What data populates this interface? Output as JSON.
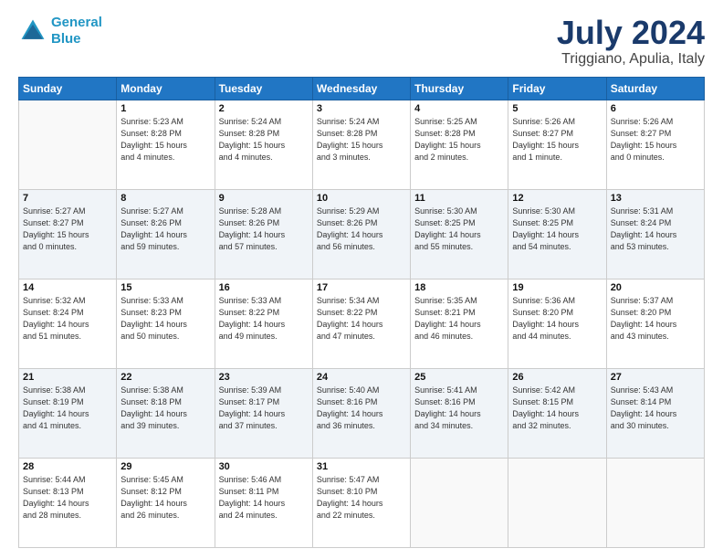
{
  "header": {
    "logo_line1": "General",
    "logo_line2": "Blue",
    "title": "July 2024",
    "subtitle": "Triggiano, Apulia, Italy"
  },
  "days_of_week": [
    "Sunday",
    "Monday",
    "Tuesday",
    "Wednesday",
    "Thursday",
    "Friday",
    "Saturday"
  ],
  "weeks": [
    [
      {
        "day": "",
        "info": ""
      },
      {
        "day": "1",
        "info": "Sunrise: 5:23 AM\nSunset: 8:28 PM\nDaylight: 15 hours\nand 4 minutes."
      },
      {
        "day": "2",
        "info": "Sunrise: 5:24 AM\nSunset: 8:28 PM\nDaylight: 15 hours\nand 4 minutes."
      },
      {
        "day": "3",
        "info": "Sunrise: 5:24 AM\nSunset: 8:28 PM\nDaylight: 15 hours\nand 3 minutes."
      },
      {
        "day": "4",
        "info": "Sunrise: 5:25 AM\nSunset: 8:28 PM\nDaylight: 15 hours\nand 2 minutes."
      },
      {
        "day": "5",
        "info": "Sunrise: 5:26 AM\nSunset: 8:27 PM\nDaylight: 15 hours\nand 1 minute."
      },
      {
        "day": "6",
        "info": "Sunrise: 5:26 AM\nSunset: 8:27 PM\nDaylight: 15 hours\nand 0 minutes."
      }
    ],
    [
      {
        "day": "7",
        "info": "Sunrise: 5:27 AM\nSunset: 8:27 PM\nDaylight: 15 hours\nand 0 minutes."
      },
      {
        "day": "8",
        "info": "Sunrise: 5:27 AM\nSunset: 8:26 PM\nDaylight: 14 hours\nand 59 minutes."
      },
      {
        "day": "9",
        "info": "Sunrise: 5:28 AM\nSunset: 8:26 PM\nDaylight: 14 hours\nand 57 minutes."
      },
      {
        "day": "10",
        "info": "Sunrise: 5:29 AM\nSunset: 8:26 PM\nDaylight: 14 hours\nand 56 minutes."
      },
      {
        "day": "11",
        "info": "Sunrise: 5:30 AM\nSunset: 8:25 PM\nDaylight: 14 hours\nand 55 minutes."
      },
      {
        "day": "12",
        "info": "Sunrise: 5:30 AM\nSunset: 8:25 PM\nDaylight: 14 hours\nand 54 minutes."
      },
      {
        "day": "13",
        "info": "Sunrise: 5:31 AM\nSunset: 8:24 PM\nDaylight: 14 hours\nand 53 minutes."
      }
    ],
    [
      {
        "day": "14",
        "info": "Sunrise: 5:32 AM\nSunset: 8:24 PM\nDaylight: 14 hours\nand 51 minutes."
      },
      {
        "day": "15",
        "info": "Sunrise: 5:33 AM\nSunset: 8:23 PM\nDaylight: 14 hours\nand 50 minutes."
      },
      {
        "day": "16",
        "info": "Sunrise: 5:33 AM\nSunset: 8:22 PM\nDaylight: 14 hours\nand 49 minutes."
      },
      {
        "day": "17",
        "info": "Sunrise: 5:34 AM\nSunset: 8:22 PM\nDaylight: 14 hours\nand 47 minutes."
      },
      {
        "day": "18",
        "info": "Sunrise: 5:35 AM\nSunset: 8:21 PM\nDaylight: 14 hours\nand 46 minutes."
      },
      {
        "day": "19",
        "info": "Sunrise: 5:36 AM\nSunset: 8:20 PM\nDaylight: 14 hours\nand 44 minutes."
      },
      {
        "day": "20",
        "info": "Sunrise: 5:37 AM\nSunset: 8:20 PM\nDaylight: 14 hours\nand 43 minutes."
      }
    ],
    [
      {
        "day": "21",
        "info": "Sunrise: 5:38 AM\nSunset: 8:19 PM\nDaylight: 14 hours\nand 41 minutes."
      },
      {
        "day": "22",
        "info": "Sunrise: 5:38 AM\nSunset: 8:18 PM\nDaylight: 14 hours\nand 39 minutes."
      },
      {
        "day": "23",
        "info": "Sunrise: 5:39 AM\nSunset: 8:17 PM\nDaylight: 14 hours\nand 37 minutes."
      },
      {
        "day": "24",
        "info": "Sunrise: 5:40 AM\nSunset: 8:16 PM\nDaylight: 14 hours\nand 36 minutes."
      },
      {
        "day": "25",
        "info": "Sunrise: 5:41 AM\nSunset: 8:16 PM\nDaylight: 14 hours\nand 34 minutes."
      },
      {
        "day": "26",
        "info": "Sunrise: 5:42 AM\nSunset: 8:15 PM\nDaylight: 14 hours\nand 32 minutes."
      },
      {
        "day": "27",
        "info": "Sunrise: 5:43 AM\nSunset: 8:14 PM\nDaylight: 14 hours\nand 30 minutes."
      }
    ],
    [
      {
        "day": "28",
        "info": "Sunrise: 5:44 AM\nSunset: 8:13 PM\nDaylight: 14 hours\nand 28 minutes."
      },
      {
        "day": "29",
        "info": "Sunrise: 5:45 AM\nSunset: 8:12 PM\nDaylight: 14 hours\nand 26 minutes."
      },
      {
        "day": "30",
        "info": "Sunrise: 5:46 AM\nSunset: 8:11 PM\nDaylight: 14 hours\nand 24 minutes."
      },
      {
        "day": "31",
        "info": "Sunrise: 5:47 AM\nSunset: 8:10 PM\nDaylight: 14 hours\nand 22 minutes."
      },
      {
        "day": "",
        "info": ""
      },
      {
        "day": "",
        "info": ""
      },
      {
        "day": "",
        "info": ""
      }
    ]
  ]
}
